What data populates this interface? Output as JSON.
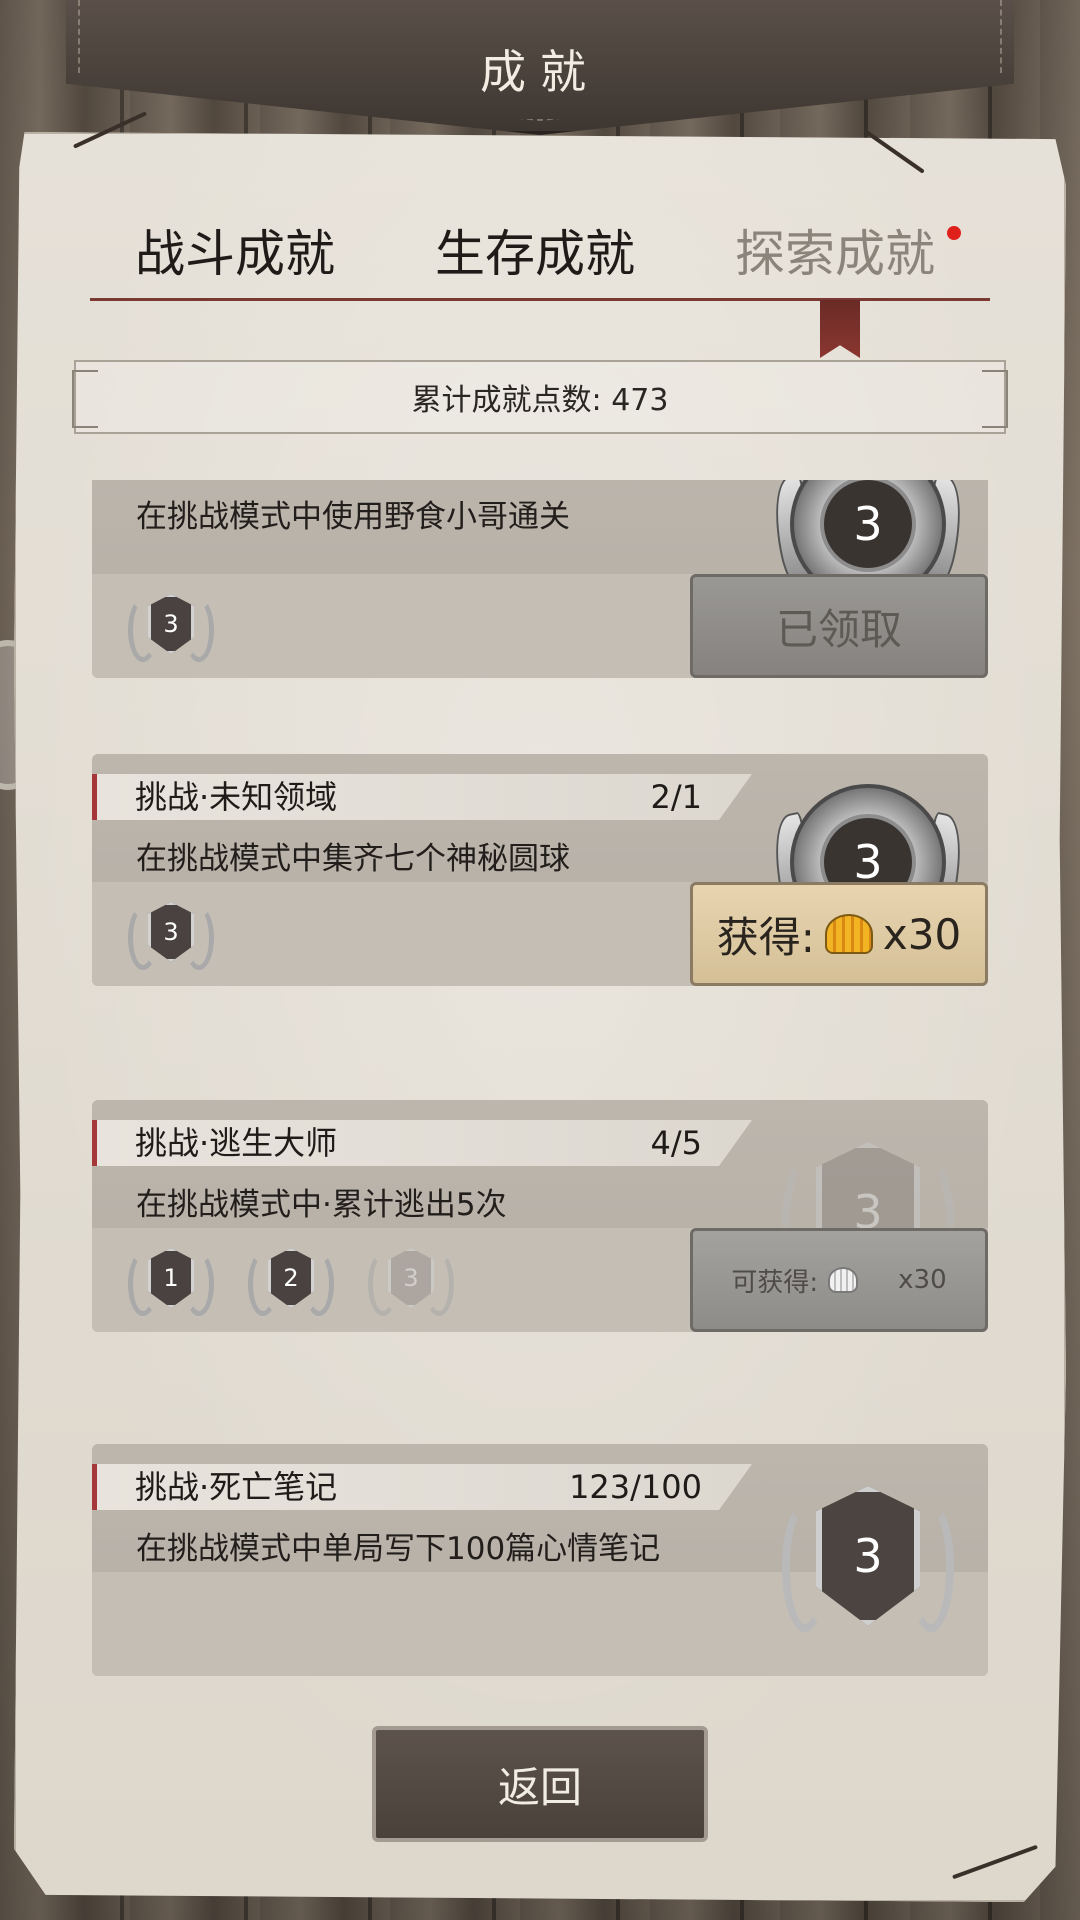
{
  "header": {
    "title": "成就"
  },
  "tabs": [
    {
      "label": "战斗成就",
      "active": false
    },
    {
      "label": "生存成就",
      "active": false
    },
    {
      "label": "探索成就",
      "active": true,
      "has_notification_dot": true
    }
  ],
  "points": {
    "label": "累计成就点数: 473"
  },
  "achievements": [
    {
      "title": "",
      "progress": "",
      "description": "在挑战模式中使用野食小哥通关",
      "badge_level": "3",
      "badge_style": "medal",
      "tiers": [
        "3"
      ],
      "action": {
        "state": "claimed",
        "label": "已领取"
      }
    },
    {
      "title": "挑战·未知领域",
      "progress": "2/1",
      "description": "在挑战模式中集齐七个神秘圆球",
      "badge_level": "3",
      "badge_style": "medal",
      "tiers": [
        "3"
      ],
      "action": {
        "state": "claim",
        "label": "获得:",
        "reward_icon": "shell-icon",
        "amount": "x30"
      }
    },
    {
      "title": "挑战·逃生大师",
      "progress": "4/5",
      "description": "在挑战模式中·累计逃出5次",
      "badge_level": "3",
      "badge_style": "shield-faded",
      "tiers": [
        "1",
        "2",
        "3"
      ],
      "action": {
        "state": "pending",
        "label": "可获得:",
        "reward_icon": "shell-icon",
        "amount": "x30"
      }
    },
    {
      "title": "挑战·死亡笔记",
      "progress": "123/100",
      "description": "在挑战模式中单局写下100篇心情笔记",
      "badge_level": "3",
      "badge_style": "shield"
    }
  ],
  "footer": {
    "return_label": "返回"
  },
  "colors": {
    "accent_red": "#a5373a",
    "notification_dot": "#e0201a",
    "parchment": "#e6e1d8",
    "button_dark": "#4a413b"
  }
}
